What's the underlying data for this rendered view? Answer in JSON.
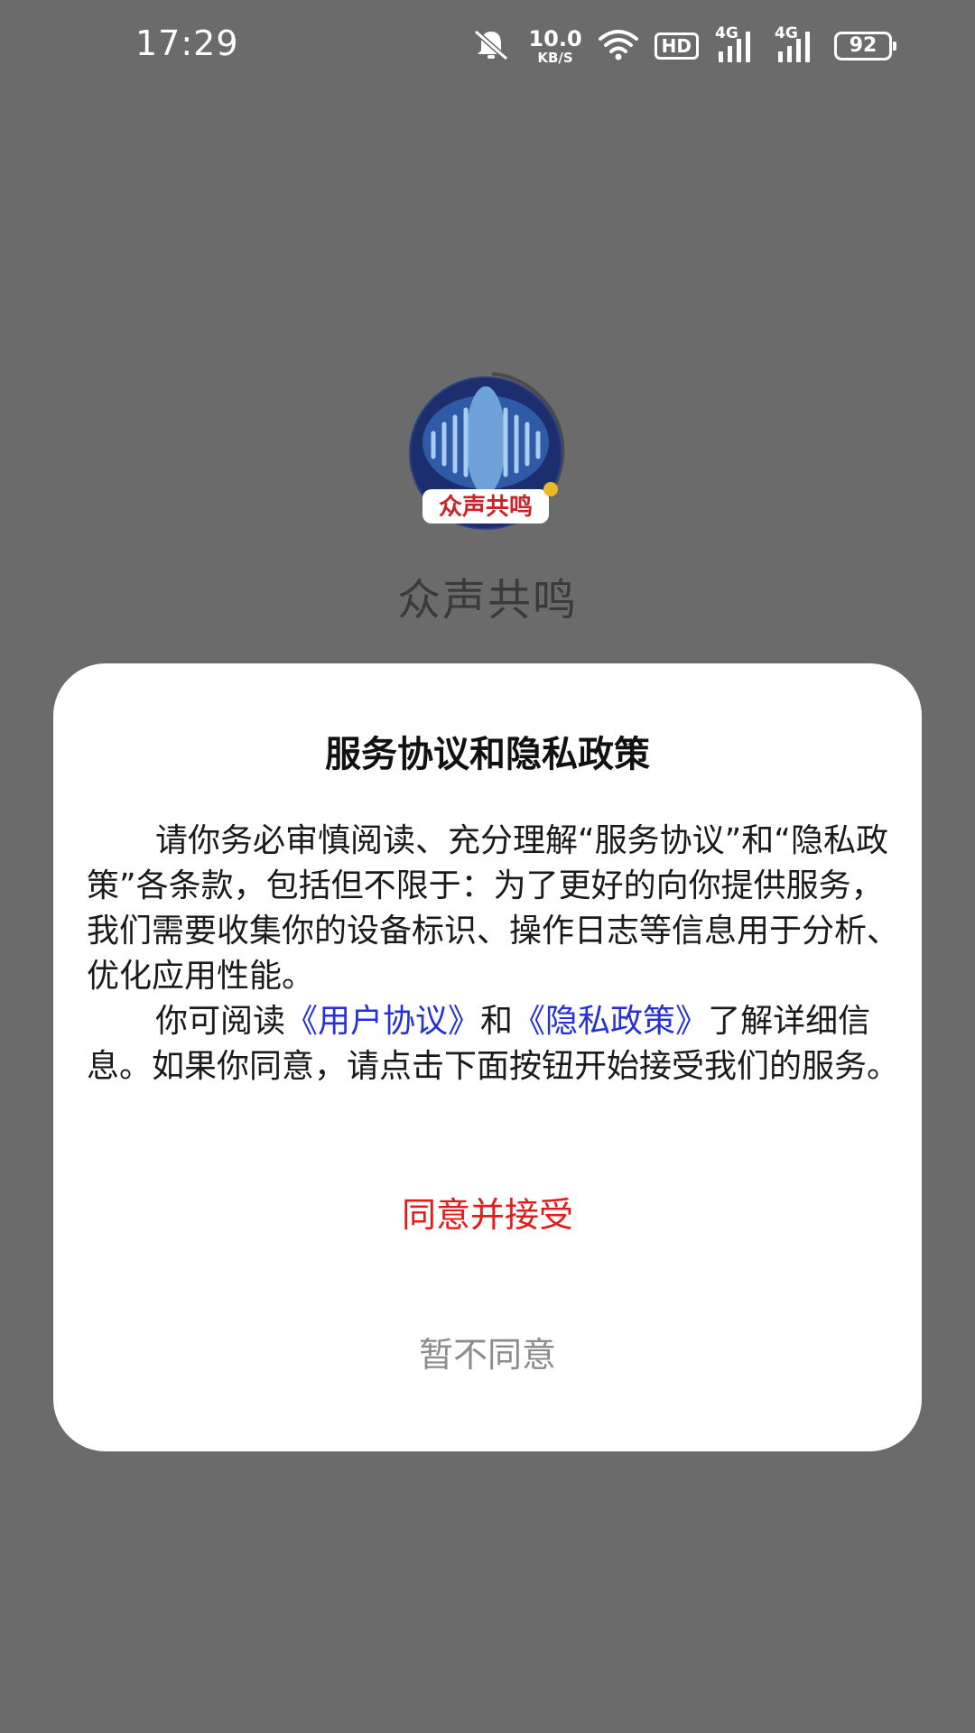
{
  "status_bar": {
    "time": "17:29",
    "net_speed_value": "10.0",
    "net_speed_unit": "KB/S",
    "hd_label": "HD",
    "signal1_label": "4G",
    "signal2_label": "4G",
    "battery": "92"
  },
  "splash": {
    "logo_text": "众声共鸣",
    "app_name": "众声共鸣"
  },
  "dialog": {
    "title": "服务协议和隐私政策",
    "paragraph1": "请你务必审慎阅读、充分理解“服务协议”和“隐私政策”各条款，包括但不限于：为了更好的向你提供服务，我们需要收集你的设备标识、操作日志等信息用于分析、优化应用性能。",
    "p2_prefix": "你可阅读",
    "user_agreement_link": "《用户协议》",
    "p2_and": "和",
    "privacy_policy_link": "《隐私政策》",
    "p2_suffix": "了解详细信息。如果你同意，请点击下面按钮开始接受我们的服务。",
    "agree_label": "同意并接受",
    "disagree_label": "暂不同意"
  },
  "colors": {
    "overlay": "#6b6b6b",
    "accent_red": "#e21b1b",
    "link_blue": "#2530d6",
    "muted_gray": "#8c8c8c"
  }
}
